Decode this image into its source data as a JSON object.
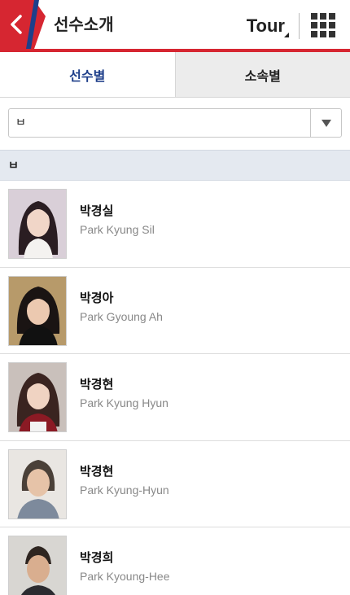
{
  "header": {
    "title": "선수소개",
    "tour_label": "Tour",
    "back_icon": "chevron-left-icon",
    "menu_icon": "grid-menu-icon",
    "accent": "#d62631",
    "brand_blue": "#1e3f8a"
  },
  "tabs": [
    {
      "label": "선수별",
      "active": true
    },
    {
      "label": "소속별",
      "active": false
    }
  ],
  "filter": {
    "selected": "ㅂ"
  },
  "group": {
    "label": "ㅂ"
  },
  "players": [
    {
      "name_ko": "박경실",
      "name_en": "Park Kyung Sil"
    },
    {
      "name_ko": "박경아",
      "name_en": "Park Gyoung Ah"
    },
    {
      "name_ko": "박경현",
      "name_en": "Park Kyung Hyun"
    },
    {
      "name_ko": "박경현",
      "name_en": "Park Kyung-Hyun"
    },
    {
      "name_ko": "박경희",
      "name_en": "Park Kyoung-Hee"
    }
  ]
}
